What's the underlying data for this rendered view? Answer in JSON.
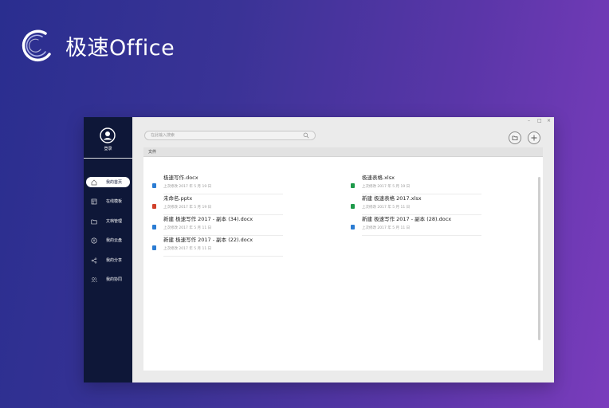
{
  "brand": {
    "name": "极速Office"
  },
  "sidebar": {
    "login_label": "登录",
    "items": [
      {
        "label": "我的首页",
        "icon": "home-icon",
        "active": true
      },
      {
        "label": "在线模板",
        "icon": "template-icon",
        "active": false
      },
      {
        "label": "文档管理",
        "icon": "folder-icon",
        "active": false
      },
      {
        "label": "我的云盘",
        "icon": "cloud-icon",
        "active": false
      },
      {
        "label": "我的分享",
        "icon": "share-icon",
        "active": false
      },
      {
        "label": "我的协同",
        "icon": "users-icon",
        "active": false
      }
    ]
  },
  "search": {
    "placeholder": "在此输入搜索"
  },
  "window_controls": {
    "minimize": "–",
    "maximize": "□",
    "close": "×"
  },
  "files_section": {
    "title": "文件"
  },
  "files": [
    {
      "name": "极速写作.docx",
      "date": "上次修改 2017 年 5 月 19 日",
      "type": "docx",
      "color": "#2b7cd3"
    },
    {
      "name": "极速表格.xlsx",
      "date": "上次修改 2017 年 5 月 19 日",
      "type": "xlsx",
      "color": "#1e9a4a"
    },
    {
      "name": "未命名.pptx",
      "date": "上次修改 2017 年 5 月 19 日",
      "type": "pptx",
      "color": "#d0402a"
    },
    {
      "name": "新建 极速表格 2017.xlsx",
      "date": "上次修改 2017 年 5 月 11 日",
      "type": "xlsx",
      "color": "#1e9a4a"
    },
    {
      "name": "新建 极速写作 2017 - 副本 (34).docx",
      "date": "上次修改 2017 年 5 月 11 日",
      "type": "docx",
      "color": "#2b7cd3"
    },
    {
      "name": "新建 极速写作 2017 - 副本 (28).docx",
      "date": "上次修改 2017 年 5 月 11 日",
      "type": "docx",
      "color": "#2b7cd3"
    },
    {
      "name": "新建 极速写作 2017 - 副本 (22).docx",
      "date": "上次修改 2017 年 5 月 11 日",
      "type": "docx",
      "color": "#2b7cd3"
    }
  ]
}
